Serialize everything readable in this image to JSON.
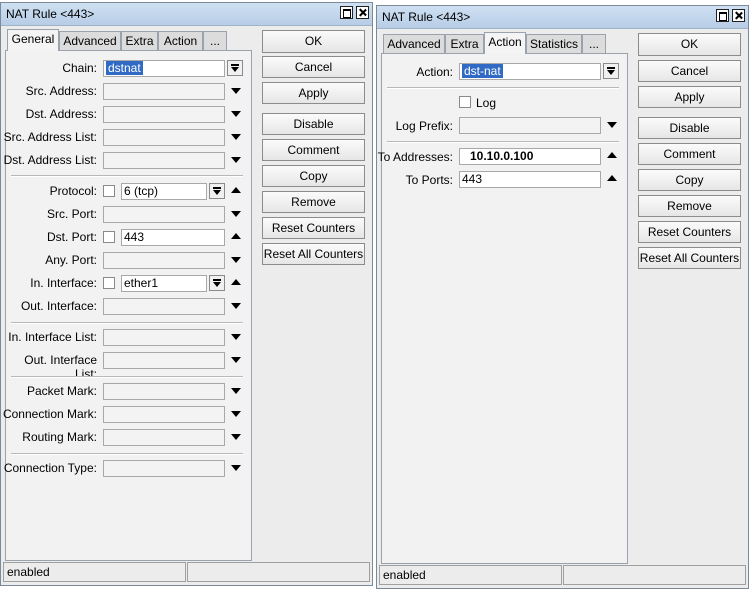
{
  "left": {
    "title": "NAT Rule <443>",
    "tabs": [
      "General",
      "Advanced",
      "Extra",
      "Action",
      "..."
    ],
    "fields": {
      "chain": {
        "label": "Chain:",
        "value": "dstnat"
      },
      "src_address": {
        "label": "Src. Address:"
      },
      "dst_address": {
        "label": "Dst. Address:"
      },
      "src_address_list": {
        "label": "Src. Address List:"
      },
      "dst_address_list": {
        "label": "Dst. Address List:"
      },
      "protocol": {
        "label": "Protocol:",
        "value": "6 (tcp)"
      },
      "src_port": {
        "label": "Src. Port:"
      },
      "dst_port": {
        "label": "Dst. Port:",
        "value": "443"
      },
      "any_port": {
        "label": "Any. Port:"
      },
      "in_interface": {
        "label": "In. Interface:",
        "value": "ether1"
      },
      "out_interface": {
        "label": "Out. Interface:"
      },
      "in_interface_list": {
        "label": "In. Interface List:"
      },
      "out_interface_list": {
        "label": "Out. Interface List:"
      },
      "packet_mark": {
        "label": "Packet Mark:"
      },
      "connection_mark": {
        "label": "Connection Mark:"
      },
      "routing_mark": {
        "label": "Routing Mark:"
      },
      "connection_type": {
        "label": "Connection Type:"
      }
    },
    "buttons": [
      "OK",
      "Cancel",
      "Apply",
      "Disable",
      "Comment",
      "Copy",
      "Remove",
      "Reset Counters",
      "Reset All Counters"
    ],
    "status": "enabled"
  },
  "right": {
    "title": "NAT Rule <443>",
    "tabs": [
      "Advanced",
      "Extra",
      "Action",
      "Statistics",
      "..."
    ],
    "fields": {
      "action": {
        "label": "Action:",
        "value": "dst-nat"
      },
      "log": {
        "label": "Log"
      },
      "log_prefix": {
        "label": "Log Prefix:"
      },
      "to_addresses": {
        "label": "To Addresses:",
        "value": "10.10.0.100"
      },
      "to_ports": {
        "label": "To Ports:",
        "value": "443"
      }
    },
    "buttons": [
      "OK",
      "Cancel",
      "Apply",
      "Disable",
      "Comment",
      "Copy",
      "Remove",
      "Reset Counters",
      "Reset All Counters"
    ],
    "status": "enabled"
  }
}
